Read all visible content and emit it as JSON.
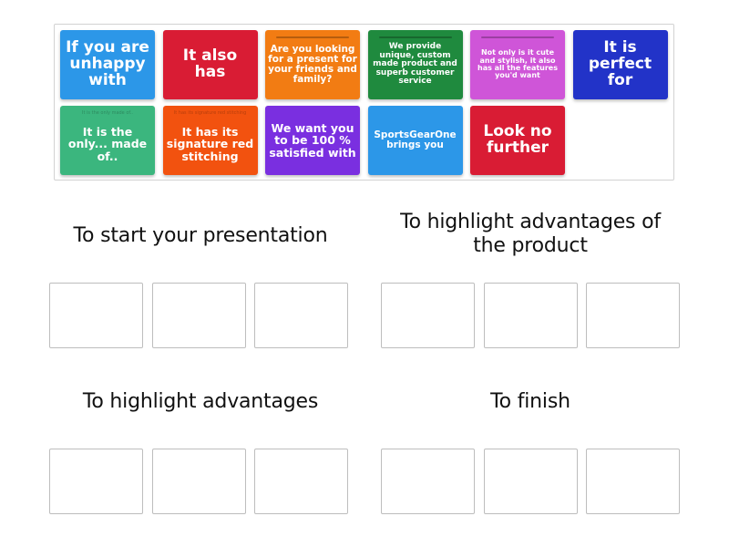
{
  "bank": {
    "tiles": [
      {
        "text": "If you are unhappy with",
        "color": "#2c97e8",
        "size": "fs-xl",
        "decor": "none"
      },
      {
        "text": "It also has",
        "color": "#d91c34",
        "size": "fs-xl",
        "decor": "none"
      },
      {
        "text": "Are you looking for a present for your friends and family?",
        "color": "#f27c13",
        "size": "fs-s",
        "decor": "bar"
      },
      {
        "text": "We provide unique, custom made product and superb customer service",
        "color": "#1f8a3e",
        "size": "fs-xs",
        "decor": "bar"
      },
      {
        "text": "Not only is it cute and stylish, it also has all the features you'd want",
        "color": "#cf55d8",
        "size": "fs-xxs",
        "decor": "bar"
      },
      {
        "text": "It is perfect for",
        "color": "#2233c8",
        "size": "fs-xl",
        "decor": "none"
      },
      {
        "text": "It is the only... made of..",
        "color": "#3bb67e",
        "size": "fs-m",
        "decor": "tiny",
        "tiny": "It is the only made of.."
      },
      {
        "text": "It has its signature red stitching",
        "color": "#f2520f",
        "size": "fs-m",
        "decor": "tiny",
        "tiny": "It has its signature red stitching"
      },
      {
        "text": "We want you to be 100 % satisfied with",
        "color": "#7a2fe0",
        "size": "fs-m",
        "decor": "none"
      },
      {
        "text": "SportsGearOne brings you",
        "color": "#2c97e8",
        "size": "fs-s",
        "decor": "none"
      },
      {
        "text": "Look no further",
        "color": "#d91c34",
        "size": "fs-xl",
        "decor": "none"
      }
    ]
  },
  "categories": [
    {
      "title": "To start your presentation",
      "slots": 3
    },
    {
      "title": "To highlight advantages of the product",
      "slots": 3
    },
    {
      "title": "To highlight advantages",
      "slots": 3
    },
    {
      "title": "To finish",
      "slots": 3
    }
  ]
}
